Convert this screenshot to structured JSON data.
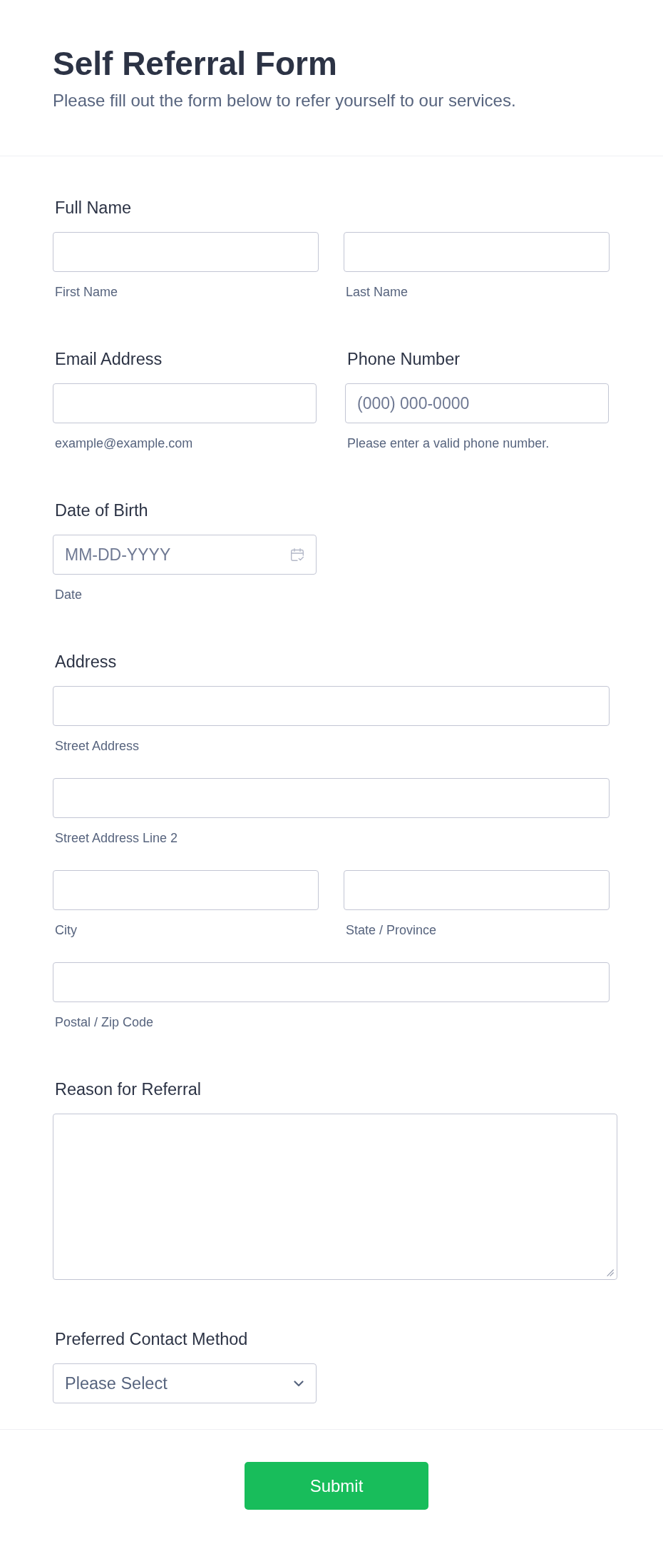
{
  "header": {
    "title": "Self Referral Form",
    "subtitle": "Please fill out the form below to refer yourself to our services."
  },
  "sections": [
    {
      "kind": "inputs",
      "label": "Full Name",
      "rows": [
        {
          "inputs": [
            {
              "sublabel": "First Name"
            },
            {
              "sublabel": "Last Name"
            }
          ]
        }
      ]
    },
    {
      "kind": "columns",
      "fields": [
        {
          "label": "Email Address",
          "sublabel": "example@example.com"
        },
        {
          "label": "Phone Number",
          "placeholder": "(000) 000-0000",
          "sublabel": "Please enter a valid phone number."
        }
      ]
    },
    {
      "kind": "date",
      "label": "Date of Birth",
      "placeholder": "MM-DD-YYYY",
      "sublabel": "Date"
    },
    {
      "kind": "inputs",
      "label": "Address",
      "rows": [
        {
          "inputs": [
            {
              "sublabel": "Street Address"
            }
          ]
        },
        {
          "inputs": [
            {
              "sublabel": "Street Address Line 2"
            }
          ]
        },
        {
          "inputs": [
            {
              "sublabel": "City"
            },
            {
              "sublabel": "State / Province"
            }
          ]
        },
        {
          "inputs": [
            {
              "sublabel": "Postal / Zip Code"
            }
          ]
        }
      ]
    },
    {
      "kind": "textarea",
      "label": "Reason for Referral"
    },
    {
      "kind": "select",
      "label": "Preferred Contact Method",
      "value": "Please Select"
    }
  ],
  "submit": {
    "label": "Submit"
  }
}
